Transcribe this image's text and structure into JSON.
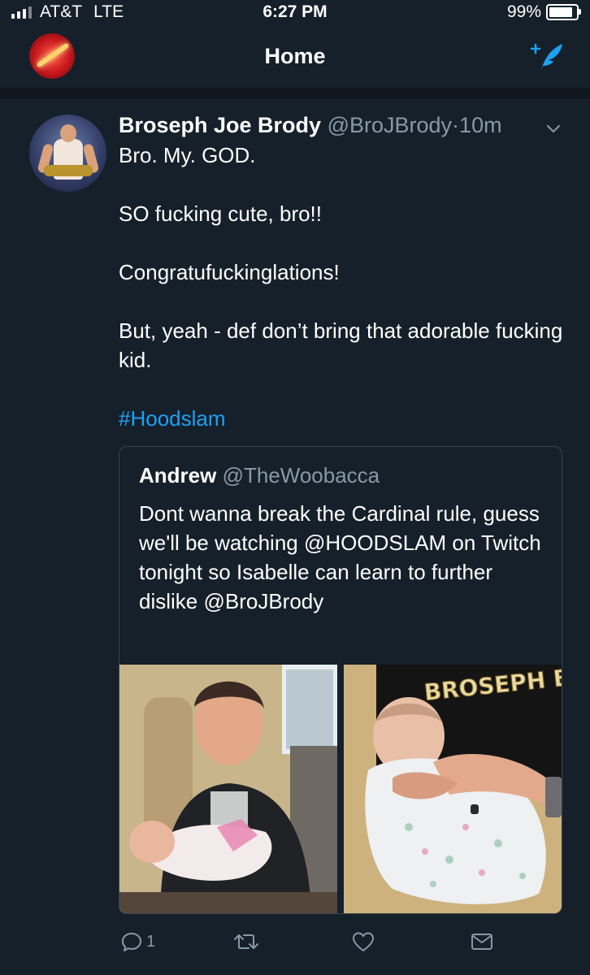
{
  "status_bar": {
    "carrier": "AT&T",
    "network": "LTE",
    "time": "6:27 PM",
    "battery": "99%",
    "battery_level": 0.99
  },
  "nav": {
    "title": "Home",
    "compose_icon": "compose-tweet-icon"
  },
  "tweet": {
    "author_name": "Broseph Joe Brody",
    "author_handle": "@BroJBrody",
    "separator": "·",
    "time_ago": "10m",
    "lines": [
      "Bro. My. GOD.",
      "SO fucking cute, bro!!",
      "Congratufuckinglations!",
      "But, yeah - def don’t bring that adorable fucking kid."
    ],
    "hashtag": "#Hoodslam",
    "quote": {
      "author_name": "Andrew",
      "author_handle": "@TheWoobacca",
      "text": "Dont wanna break the Cardinal rule, guess we'll be watching @HOODSLAM on Twitch tonight so Isabelle can learn to further dislike @BroJBrody",
      "media_shirt_text": "BROSEPH BRODY"
    },
    "actions": {
      "reply_count": "1",
      "retweet_count": "",
      "like_count": ""
    }
  },
  "colors": {
    "background": "#15202b",
    "text_secondary": "#8899a6",
    "accent": "#1da1f2",
    "border": "#38444d"
  }
}
